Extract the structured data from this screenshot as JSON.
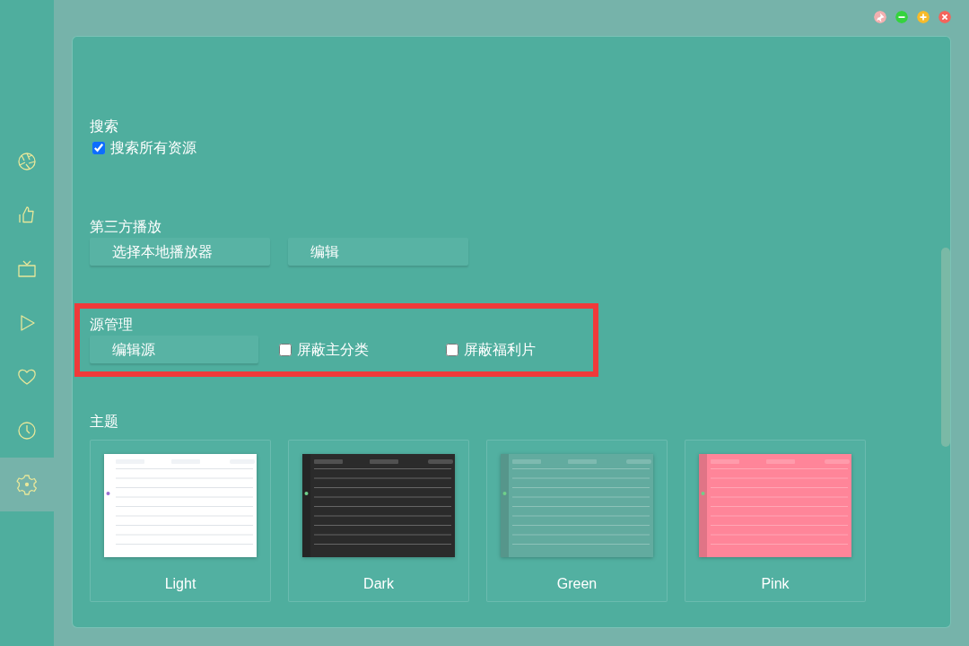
{
  "window_controls": [
    {
      "kind": "pin"
    },
    {
      "kind": "minimize"
    },
    {
      "kind": "maximize"
    },
    {
      "kind": "close"
    }
  ],
  "sidebar": {
    "items": [
      {
        "kind": "aperture",
        "selected": false
      },
      {
        "kind": "thumbs-up",
        "selected": false
      },
      {
        "kind": "tv",
        "selected": false
      },
      {
        "kind": "play",
        "selected": false
      },
      {
        "kind": "heart",
        "selected": false
      },
      {
        "kind": "clock",
        "selected": false
      },
      {
        "kind": "settings",
        "selected": true
      }
    ]
  },
  "sections": [
    {
      "title": "搜索",
      "highlighted": false,
      "controls": [
        {
          "kind": "checkbox",
          "label": "搜索所有资源",
          "checked": true
        }
      ]
    },
    {
      "title": "第三方播放",
      "highlighted": false,
      "controls": [
        {
          "kind": "button",
          "label": "选择本地播放器"
        },
        {
          "kind": "button",
          "label": "编辑"
        }
      ]
    },
    {
      "title": "源管理",
      "highlighted": true,
      "controls": [
        {
          "kind": "button",
          "label": "编辑源"
        },
        {
          "kind": "checkbox",
          "label": "屏蔽主分类",
          "checked": false
        },
        {
          "kind": "checkbox",
          "label": "屏蔽福利片",
          "checked": false
        }
      ]
    }
  ],
  "theme": {
    "title": "主题",
    "items": [
      {
        "name": "Light",
        "kind": "picture",
        "color": "#ffffff"
      },
      {
        "name": "Dark",
        "kind": "picture",
        "color": "#2b2b2b"
      },
      {
        "name": "Green",
        "kind": "picture",
        "color": "#62ab9f"
      },
      {
        "name": "Pink",
        "kind": "picture",
        "color": "#ff8599"
      }
    ]
  }
}
